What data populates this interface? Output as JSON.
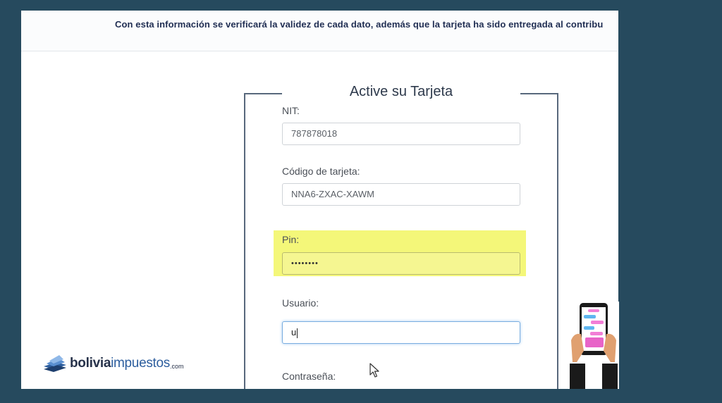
{
  "banner": {
    "text": "Con esta información se verificará la validez de cada dato, además que la tarjeta ha sido entregada al contribu"
  },
  "form": {
    "title": "Active su Tarjeta",
    "nit": {
      "label": "NIT:",
      "value": "787878018"
    },
    "codigo": {
      "label": "Código de tarjeta:",
      "value": "NNA6-ZXAC-XAWM"
    },
    "pin": {
      "label": "Pin:",
      "value": "••••••••"
    },
    "usuario": {
      "label": "Usuario:",
      "value": "u"
    },
    "contrasena": {
      "label": "Contraseña:"
    }
  },
  "brand": {
    "part1": "bolivia",
    "part2": "impuestos",
    "part3": ".com"
  },
  "colors": {
    "background": "#264a5e",
    "highlight": "#f4f779",
    "brand_dark": "#27324a",
    "brand_blue": "#2d5e9e"
  },
  "icons": [
    "mouse-pointer-icon",
    "books-logo-icon",
    "phone-hands-illustration"
  ]
}
